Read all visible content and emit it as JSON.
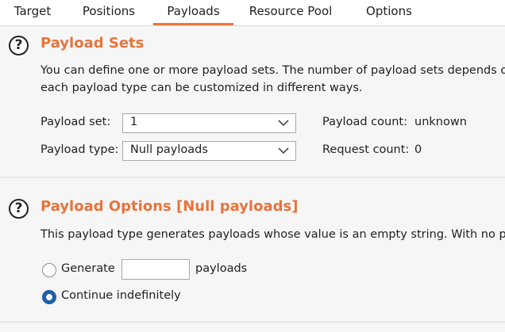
{
  "tabs": [
    {
      "label": "Target"
    },
    {
      "label": "Positions"
    },
    {
      "label": "Payloads",
      "active": true
    },
    {
      "label": "Resource Pool"
    },
    {
      "label": "Options"
    }
  ],
  "payload_sets": {
    "help_glyph": "?",
    "title": "Payload Sets",
    "description_line1": "You can define one or more payload sets. The number of payload sets depends o",
    "description_line2": "each payload type can be customized in different ways.",
    "set_label": "Payload set:",
    "set_value": "1",
    "type_label": "Payload type:",
    "type_value": "Null payloads",
    "count_label": "Payload count:",
    "count_value": "unknown",
    "request_label": "Request count:",
    "request_value": "0"
  },
  "payload_options": {
    "help_glyph": "?",
    "title": "Payload Options [Null payloads]",
    "description": "This payload type generates payloads whose value is an empty string. With no pa",
    "generate_label": "Generate",
    "generate_value": "",
    "payloads_suffix": "payloads",
    "continue_label": "Continue indefinitely",
    "selected_option": "continue"
  },
  "colors": {
    "accent": "#e8743b",
    "radio_selected": "#1f5fa8",
    "section_bg": "#f6f6f6"
  }
}
